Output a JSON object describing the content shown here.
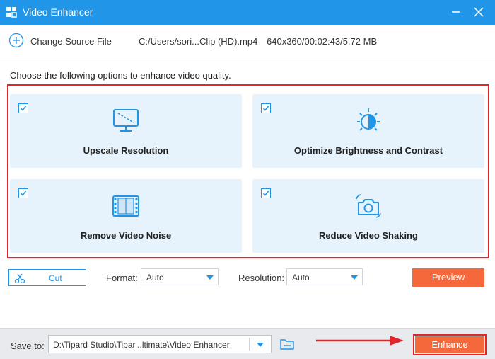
{
  "window": {
    "title": "Video Enhancer",
    "icons": [
      "app-grid-icon",
      "minimize-icon",
      "close-icon"
    ]
  },
  "source": {
    "change_label": "Change Source File",
    "path": "C:/Users/sori...Clip (HD).mp4",
    "info": "640x360/00:02:43/5.72 MB"
  },
  "instruction": "Choose the following options to enhance video quality.",
  "options": [
    {
      "label": "Upscale Resolution",
      "checked": true,
      "icon": "monitor-upscale-icon"
    },
    {
      "label": "Optimize Brightness and Contrast",
      "checked": true,
      "icon": "brightness-icon"
    },
    {
      "label": "Remove Video Noise",
      "checked": true,
      "icon": "film-noise-icon"
    },
    {
      "label": "Reduce Video Shaking",
      "checked": true,
      "icon": "camera-stabilize-icon"
    }
  ],
  "controls": {
    "cut_label": "Cut",
    "format_label": "Format:",
    "format_value": "Auto",
    "resolution_label": "Resolution:",
    "resolution_value": "Auto",
    "preview_label": "Preview"
  },
  "bottom": {
    "save_label": "Save to:",
    "save_path": "D:\\Tipard Studio\\Tipar...ltimate\\Video Enhancer",
    "enhance_label": "Enhance"
  },
  "colors": {
    "accent": "#2196e8",
    "action": "#f5683c",
    "highlight": "#e0262a",
    "card_bg": "#e6f3fc"
  }
}
